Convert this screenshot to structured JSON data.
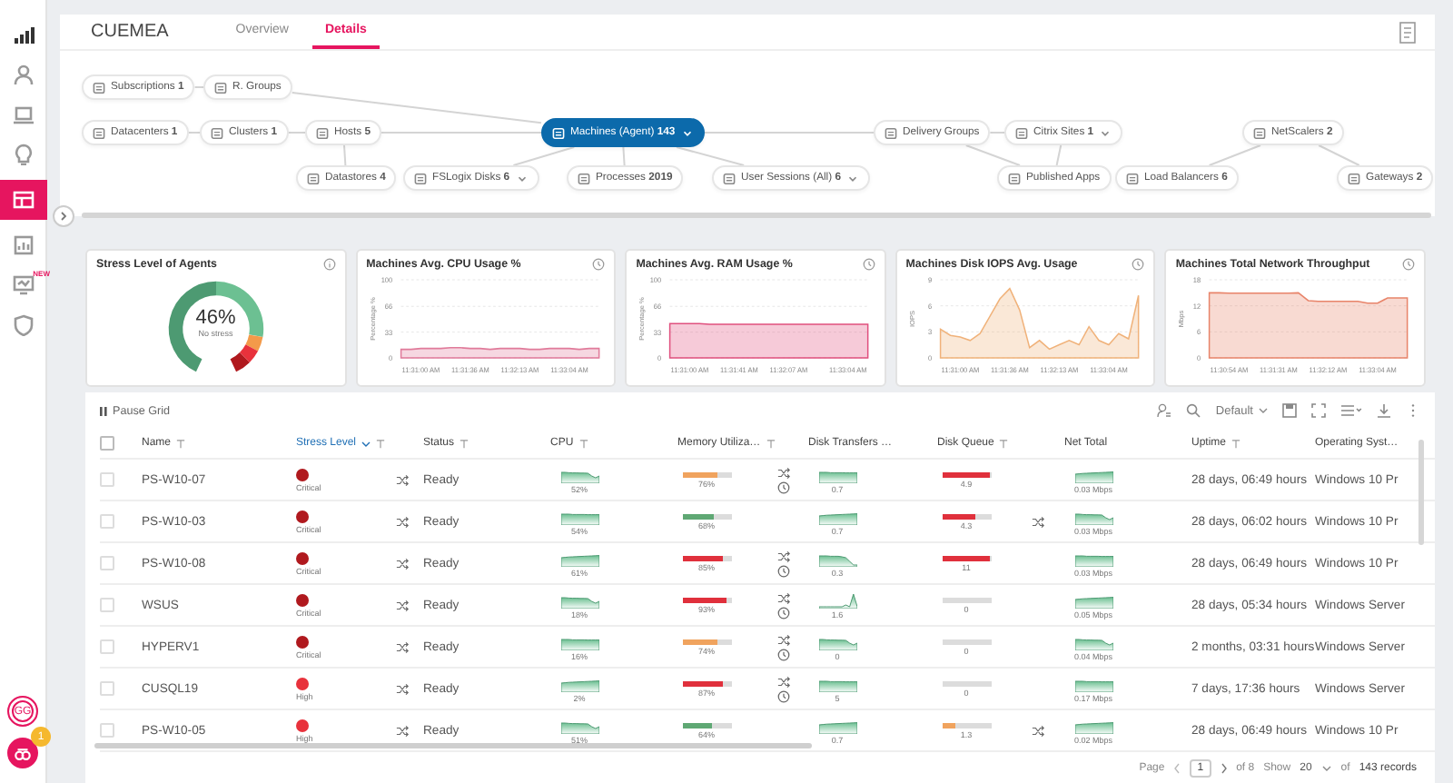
{
  "sidebar": {
    "items": [
      {
        "kind": "signal",
        "selected": false
      },
      {
        "kind": "user",
        "selected": false
      },
      {
        "kind": "laptop",
        "selected": false
      },
      {
        "kind": "bulb",
        "selected": false
      },
      {
        "kind": "grid",
        "selected": true
      },
      {
        "kind": "chart",
        "selected": false
      },
      {
        "kind": "monitor",
        "selected": false,
        "badge": "NEW"
      },
      {
        "kind": "shield",
        "selected": false
      }
    ],
    "avatar": "GG",
    "notifications": "1"
  },
  "header": {
    "title": "CUEMEA",
    "tabs": [
      {
        "label": "Overview",
        "selected": false
      },
      {
        "label": "Details",
        "selected": true
      }
    ]
  },
  "topology": {
    "nodes": [
      {
        "label": "Subscriptions **1**",
        "selected": false,
        "dropdown": false
      },
      {
        "label": "R. Groups",
        "selected": false,
        "dropdown": false
      },
      {
        "label": "Datacenters **1**",
        "selected": false,
        "dropdown": false
      },
      {
        "label": "Clusters **1**",
        "selected": false,
        "dropdown": false
      },
      {
        "label": "Hosts **5**",
        "selected": false,
        "dropdown": false
      },
      {
        "label": "Machines (Agent) **143**",
        "selected": true,
        "dropdown": true
      },
      {
        "label": "Datastores **4**",
        "selected": false,
        "dropdown": false
      },
      {
        "label": "FSLogix Disks **6**",
        "selected": false,
        "dropdown": true
      },
      {
        "label": "Processes **2019**",
        "selected": false,
        "dropdown": false
      },
      {
        "label": "User Sessions (All) **6**",
        "selected": false,
        "dropdown": true
      },
      {
        "label": "Delivery Groups",
        "selected": false,
        "dropdown": false
      },
      {
        "label": "Citrix Sites **1**",
        "selected": false,
        "dropdown": true
      },
      {
        "label": "Published Apps",
        "selected": false,
        "dropdown": false
      },
      {
        "label": "NetScalers **2**",
        "selected": false,
        "dropdown": false
      },
      {
        "label": "Load Balancers **6**",
        "selected": false,
        "dropdown": false
      },
      {
        "label": "Gateways **2**",
        "selected": false,
        "dropdown": false
      }
    ]
  },
  "stress_card": {
    "title": "Stress Level of Agents",
    "value": "46%",
    "caption": "No stress"
  },
  "charts": [
    {
      "title": "Machines Avg. CPU Usage %",
      "chart_data": {
        "type": "area",
        "ylabel": "Percentage %",
        "categories": [
          null,
          null,
          "11:31:00 AM",
          null,
          null,
          null,
          null,
          "11:31:36 AM",
          null,
          null,
          null,
          null,
          "11:32:13 AM",
          null,
          null,
          null,
          null,
          "11:33:04 AM",
          null,
          null,
          null
        ],
        "ylim": [
          0,
          100
        ],
        "yticks": [
          0,
          33,
          66,
          100
        ],
        "series": [
          {
            "color": "#e07a9a",
            "values": [
              11,
              11,
              12,
              12,
              12,
              13,
              13,
              12,
              12,
              11,
              12,
              12,
              12,
              11,
              11,
              12,
              12,
              12,
              11,
              12,
              12
            ]
          }
        ]
      }
    },
    {
      "title": "Machines Avg. RAM Usage %",
      "chart_data": {
        "type": "area",
        "ylabel": "Percentage %",
        "categories": [
          null,
          null,
          "11:31:00 AM",
          null,
          null,
          null,
          null,
          "11:31:41 AM",
          null,
          null,
          null,
          null,
          "11:32:07 AM",
          null,
          null,
          null,
          null,
          null,
          "11:33:04 AM",
          null,
          null
        ],
        "ylim": [
          0,
          100
        ],
        "yticks": [
          0,
          33,
          66,
          100
        ],
        "series": [
          {
            "color": "#e0507e",
            "values": [
              44,
              44,
              44,
              44,
              43,
              43,
              43,
              43,
              43,
              43,
              43,
              43,
              43,
              43,
              43,
              43,
              43,
              43,
              43,
              43,
              43
            ]
          }
        ]
      }
    },
    {
      "title": "Machines Disk IOPS Avg. Usage",
      "chart_data": {
        "type": "area",
        "ylabel": "IOPS",
        "categories": [
          null,
          null,
          "11:31:00 AM",
          null,
          null,
          null,
          null,
          "11:31:36 AM",
          null,
          null,
          null,
          null,
          "11:32:13 AM",
          null,
          null,
          null,
          null,
          "11:33:04 AM",
          null,
          null,
          null
        ],
        "ylim": [
          0,
          9
        ],
        "yticks": [
          0,
          3,
          6,
          9
        ],
        "series": [
          {
            "color": "#f0b27a",
            "values": [
              3.3,
              2.6,
              2.4,
              2,
              2.8,
              4.8,
              6.8,
              8,
              5.5,
              1.2,
              2,
              1,
              1.5,
              2,
              1.5,
              3.6,
              2,
              1.5,
              2.8,
              2.2,
              7.2
            ]
          }
        ]
      }
    },
    {
      "title": "Machines Total Network Throughput",
      "chart_data": {
        "type": "area",
        "ylabel": "Mbps",
        "categories": [
          null,
          null,
          "11:30:54 AM",
          null,
          null,
          null,
          null,
          "11:31:31 AM",
          null,
          null,
          null,
          null,
          "11:32:12 AM",
          null,
          null,
          null,
          null,
          "11:33:04 AM",
          null,
          null,
          null
        ],
        "ylim": [
          0,
          18
        ],
        "yticks": [
          0,
          6,
          12,
          18
        ],
        "series": [
          {
            "color": "#e8846a",
            "values": [
              15,
              15,
              14.9,
              14.9,
              14.9,
              14.9,
              14.9,
              14.9,
              14.9,
              15,
              13.2,
              13,
              13,
              13,
              13,
              13,
              12.6,
              12.6,
              13.8,
              13.8,
              13.8
            ]
          }
        ]
      }
    }
  ],
  "grid_toolbar": {
    "pause": "Pause Grid",
    "view": "Default"
  },
  "table": {
    "header_checked": false,
    "columns": [
      {
        "label": "Name",
        "filter": true,
        "sorted": false
      },
      {
        "label": "Stress Level",
        "filter": true,
        "sorted": true
      },
      {
        "label": "Status",
        "filter": true,
        "sorted": false
      },
      {
        "label": "CPU",
        "filter": true,
        "sorted": false
      },
      {
        "label": "Memory Utiliza…",
        "filter": true,
        "sorted": false
      },
      {
        "label": "Disk Transfers …",
        "filter": false,
        "sorted": false
      },
      {
        "label": "Disk Queue",
        "filter": true,
        "sorted": false
      },
      {
        "label": "Net Total",
        "filter": false,
        "sorted": false
      },
      {
        "label": "Uptime",
        "filter": true,
        "sorted": false
      },
      {
        "label": "Operating Syst…",
        "filter": false,
        "sorted": false
      }
    ],
    "rows": [
      {
        "checked": false,
        "name": "PS-W10-07",
        "stress": {
          "label": "Critical",
          "color": "#b0191e"
        },
        "shuffle": true,
        "status": "Ready",
        "cpu": "52%",
        "memory": {
          "reading": "76%",
          "level": 0.76,
          "color": "#f0a35e"
        },
        "trend_icons": true,
        "disk_transfers": "0.7",
        "disk_queue": {
          "reading": "4.9",
          "level": 1,
          "color": "#e0303c"
        },
        "net_shuffle": false,
        "net_total": "0.03 Mbps",
        "uptime": "28 days, 06:49 hours",
        "os": "Windows 10 Pr"
      },
      {
        "checked": false,
        "name": "PS-W10-03",
        "stress": {
          "label": "Critical",
          "color": "#b0191e"
        },
        "shuffle": true,
        "status": "Ready",
        "cpu": "54%",
        "memory": {
          "reading": "68%",
          "level": 0.68,
          "color": "#5fa874"
        },
        "trend_icons": false,
        "disk_transfers": "0.7",
        "disk_queue": {
          "reading": "4.3",
          "level": 0.72,
          "color": "#e0303c"
        },
        "net_shuffle": true,
        "net_total": "0.03 Mbps",
        "uptime": "28 days, 06:02 hours",
        "os": "Windows 10 Pr"
      },
      {
        "checked": false,
        "name": "PS-W10-08",
        "stress": {
          "label": "Critical",
          "color": "#b0191e"
        },
        "shuffle": true,
        "status": "Ready",
        "cpu": "61%",
        "memory": {
          "reading": "85%",
          "level": 0.85,
          "color": "#e0303c"
        },
        "trend_icons": true,
        "disk_transfers": "0.3",
        "disk_queue": {
          "reading": "11",
          "level": 1,
          "color": "#e0303c"
        },
        "net_shuffle": false,
        "net_total": "0.03 Mbps",
        "uptime": "28 days, 06:49 hours",
        "os": "Windows 10 Pr"
      },
      {
        "checked": false,
        "name": "WSUS",
        "stress": {
          "label": "Critical",
          "color": "#b0191e"
        },
        "shuffle": true,
        "status": "Ready",
        "cpu": "18%",
        "memory": {
          "reading": "93%",
          "level": 0.93,
          "color": "#e0303c"
        },
        "trend_icons": true,
        "disk_transfers": "1.6",
        "disk_queue": {
          "reading": "0",
          "level": 0
        },
        "net_shuffle": false,
        "net_total": "0.05 Mbps",
        "uptime": "28 days, 05:34 hours",
        "os": "Windows Server"
      },
      {
        "checked": false,
        "name": "HYPERV1",
        "stress": {
          "label": "Critical",
          "color": "#b0191e"
        },
        "shuffle": true,
        "status": "Ready",
        "cpu": "16%",
        "memory": {
          "reading": "74%",
          "level": 0.74,
          "color": "#f0a35e"
        },
        "trend_icons": true,
        "disk_transfers": "0",
        "disk_queue": {
          "reading": "0",
          "level": 0
        },
        "net_shuffle": false,
        "net_total": "0.04 Mbps",
        "uptime": "2 months, 03:31 hours",
        "os": "Windows Server"
      },
      {
        "checked": false,
        "name": "CUSQL19",
        "stress": {
          "label": "High",
          "color": "#e8323c"
        },
        "shuffle": true,
        "status": "Ready",
        "cpu": "2%",
        "memory": {
          "reading": "87%",
          "level": 0.87,
          "color": "#e0303c"
        },
        "trend_icons": true,
        "disk_transfers": "5",
        "disk_queue": {
          "reading": "0",
          "level": 0
        },
        "net_shuffle": false,
        "net_total": "0.17 Mbps",
        "uptime": "7 days, 17:36 hours",
        "os": "Windows Server"
      },
      {
        "checked": false,
        "name": "PS-W10-05",
        "stress": {
          "label": "High",
          "color": "#e8323c"
        },
        "shuffle": true,
        "status": "Ready",
        "cpu": "51%",
        "memory": {
          "reading": "64%",
          "level": 0.64,
          "color": "#5fa874"
        },
        "trend_icons": false,
        "disk_transfers": "0.7",
        "disk_queue": {
          "reading": "1.3",
          "level": 0.3,
          "color": "#f0a35e"
        },
        "net_shuffle": true,
        "net_total": "0.02 Mbps",
        "uptime": "28 days, 06:49 hours",
        "os": "Windows 10 Pr"
      }
    ]
  },
  "pagination": {
    "label": "Page",
    "page": "1",
    "of_pages": "of 8",
    "show_label": "Show",
    "page_size": "20",
    "of": "of",
    "records": "143 records"
  }
}
